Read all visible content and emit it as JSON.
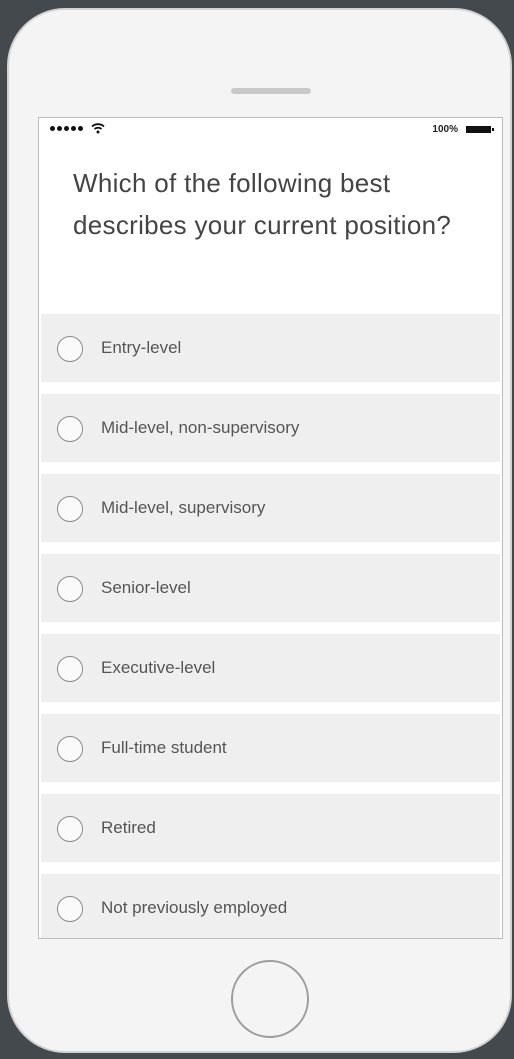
{
  "status_bar": {
    "battery_percent": "100%"
  },
  "survey": {
    "question": "Which of the following best describes your current position?",
    "options": [
      {
        "label": "Entry-level"
      },
      {
        "label": "Mid-level, non-supervisory"
      },
      {
        "label": "Mid-level, supervisory"
      },
      {
        "label": "Senior-level"
      },
      {
        "label": "Executive-level"
      },
      {
        "label": "Full-time student"
      },
      {
        "label": "Retired"
      },
      {
        "label": "Not previously employed"
      }
    ]
  },
  "colors": {
    "background": "#44494d",
    "phone_body": "#f4f4f4",
    "option_background": "#efefef",
    "text": "#444444"
  },
  "icons": [
    "signal-dots-icon",
    "wifi-icon",
    "battery-icon",
    "radio-empty-icon"
  ]
}
